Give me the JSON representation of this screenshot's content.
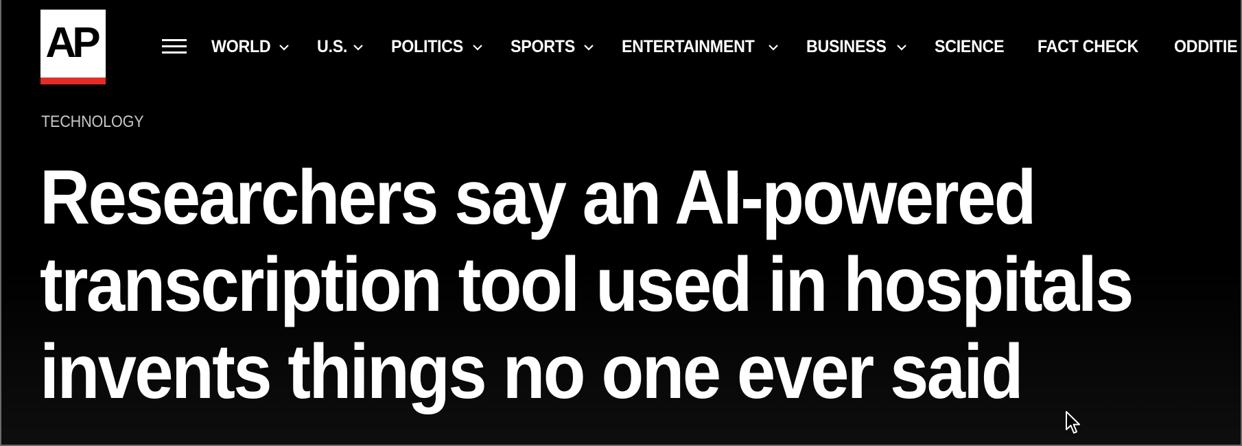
{
  "header": {
    "logo_text": "AP",
    "menu_icon": "hamburger-menu-icon",
    "nav": [
      {
        "label": "WORLD",
        "has_dropdown": true
      },
      {
        "label": "U.S.",
        "has_dropdown": true
      },
      {
        "label": "POLITICS",
        "has_dropdown": true
      },
      {
        "label": "SPORTS",
        "has_dropdown": true
      },
      {
        "label": "ENTERTAINMENT",
        "has_dropdown": true
      },
      {
        "label": "BUSINESS",
        "has_dropdown": true
      },
      {
        "label": "SCIENCE",
        "has_dropdown": false
      },
      {
        "label": "FACT CHECK",
        "has_dropdown": false
      },
      {
        "label": "ODDITIE",
        "has_dropdown": false
      }
    ]
  },
  "article": {
    "kicker": "TECHNOLOGY",
    "headline_lines": [
      "Researchers say an AI-powered",
      "transcription tool used in hospitals",
      "invents things no one ever said"
    ]
  },
  "colors": {
    "background": "#000000",
    "text": "#ffffff",
    "kicker": "#c8c8c8",
    "brand_red": "#e52d27",
    "logo_bg": "#ffffff"
  }
}
